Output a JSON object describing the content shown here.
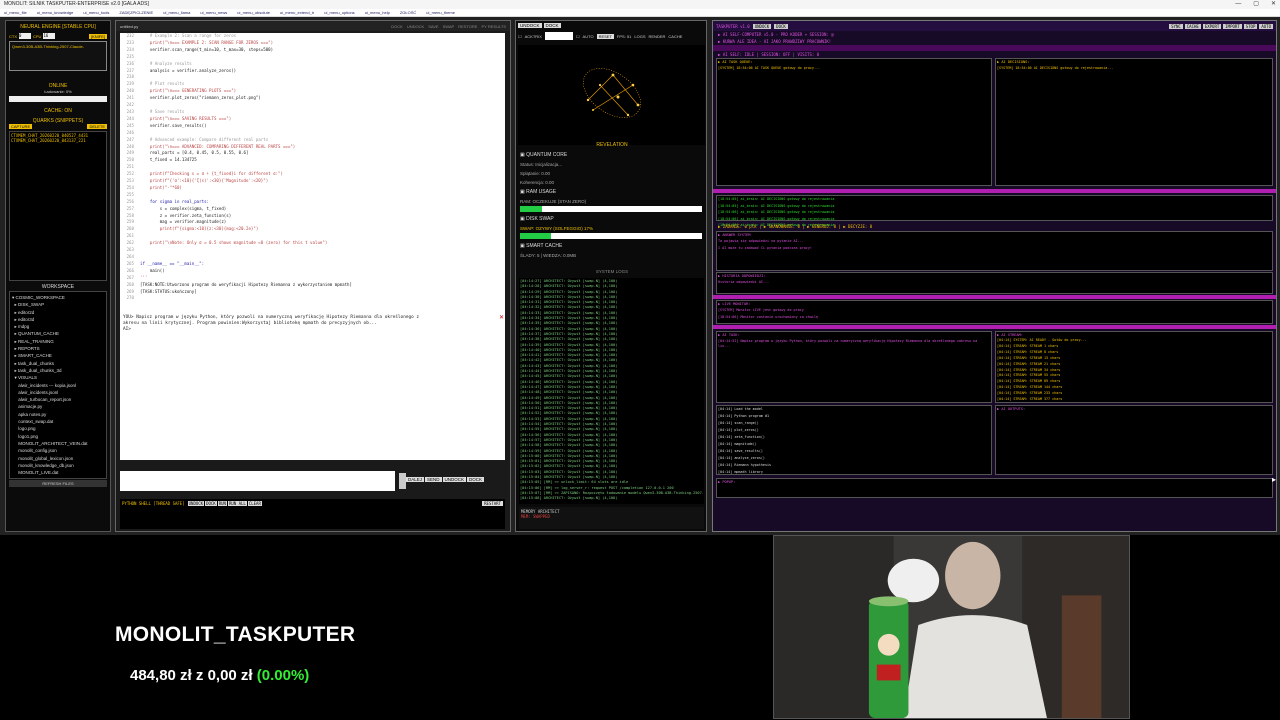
{
  "window": {
    "title": "MONOLIT: SILNIK TASKPUTER-ENTERPRISE v2.0 [GALA ADS]",
    "controls": [
      "—",
      "▢",
      "✕"
    ]
  },
  "menu": [
    "ui_menu_file",
    "ui_menu_knowledge",
    "ui_menu_tools",
    "ZADĘZPICLZENIE",
    "ui_menu_llama",
    "ui_menu_news",
    "ui_menu_obsolute",
    "ui_menu_extend_tr",
    "ui_menu_options",
    "ui_menu_help",
    "ZGŁOŚĆ",
    "ui_menu_theme"
  ],
  "left": {
    "engine_title": "NEURAL ENGINE [STABLE CPU]",
    "ctx_label": "CTX",
    "ctx_value": "0",
    "cpu_label": "CPU",
    "cpu_value": "16",
    "knife_label": "[KNIFE]",
    "model": "Qwen3-30B-A3B-Thinking-2507-Claude-",
    "online": "ONLINE",
    "loading": "Ładowanie: 0%",
    "cache": "CACHE: ON",
    "quarks_title": "QUARKS (SNIPPETS)",
    "capture": "CAPTURE",
    "delete": "DELETE",
    "quarks": [
      "CTXMEM_CHAT_20260220_040527_4431",
      "CTXMEM_CHAT_20260220_043137_221"
    ],
    "workspace_title": "WORKSPACE",
    "workspace": [
      "▾ COSMIC_WORKSPACE",
      "  ▸ DISK_SWAP",
      "  ▸ editor2d",
      "  ▸ editor3d",
      "  ▸ mdpg",
      "  ▸ QUANTUM_CACHE",
      "  ▸ REAL_TRAINING",
      "  ▸ REPORTS",
      "  ▸ SMART_CACHE",
      "  ▸ task_dual_chunks",
      "  ▸ task_dual_chunks_3d",
      "  ▾ VISUALS",
      "     alwir_incidents --- kopia.jsonl",
      "     alwir_incidents.jsonl",
      "     alwir_turbocan_report.json",
      "     animacje.py",
      "     apka notes.py",
      "     context_swap.dat",
      "     logo.png",
      "     logo1.png",
      "     MONOLIT_ARCHITECT_VEIN.dat",
      "     monolit_config.json",
      "     monolit_global_lexicon.json",
      "     monolit_knowledge_db.json",
      "     MONOLIT_LIVE.dat"
    ],
    "refresh": "REFRESH FILES"
  },
  "editor": {
    "tab": "untitled.py",
    "tab_actions": [
      "DOCK",
      "UNDOCK",
      "SAVE",
      "SWAP",
      "RESTORE",
      "PY RESULTS"
    ],
    "code": [
      {
        "n": "232",
        "t": "    # Example 2: Scan a range for zeros",
        "c": "cm"
      },
      {
        "n": "233",
        "t": "    print(\"\\n=== EXAMPLE 2: SCAN RANGE FOR ZEROS ===\")",
        "c": "st"
      },
      {
        "n": "234",
        "t": "    verifier.scan_range(t_min=10, t_max=30, steps=500)",
        "c": ""
      },
      {
        "n": "235",
        "t": "",
        "c": ""
      },
      {
        "n": "236",
        "t": "    # Analyze results",
        "c": "cm"
      },
      {
        "n": "237",
        "t": "    analysis = verifier.analyze_zeros()",
        "c": ""
      },
      {
        "n": "238",
        "t": "",
        "c": ""
      },
      {
        "n": "239",
        "t": "    # Plot results",
        "c": "cm"
      },
      {
        "n": "240",
        "t": "    print(\"\\n=== GENERATING PLOTS ===\")",
        "c": "st"
      },
      {
        "n": "241",
        "t": "    verifier.plot_zeros(\"riemann_zeros_plot.png\")",
        "c": ""
      },
      {
        "n": "242",
        "t": "",
        "c": ""
      },
      {
        "n": "243",
        "t": "    # Save results",
        "c": "cm"
      },
      {
        "n": "244",
        "t": "    print(\"\\n=== SAVING RESULTS ===\")",
        "c": "st"
      },
      {
        "n": "245",
        "t": "    verifier.save_results()",
        "c": ""
      },
      {
        "n": "246",
        "t": "",
        "c": ""
      },
      {
        "n": "247",
        "t": "    # Advanced example: Compare different real parts",
        "c": "cm"
      },
      {
        "n": "248",
        "t": "    print(\"\\n=== ADVANCED: COMPARING DIFFERENT REAL PARTS ===\")",
        "c": "st"
      },
      {
        "n": "249",
        "t": "    real_parts = [0.4, 0.45, 0.5, 0.55, 0.6]",
        "c": ""
      },
      {
        "n": "250",
        "t": "    t_fixed = 14.134725",
        "c": ""
      },
      {
        "n": "251",
        "t": "",
        "c": ""
      },
      {
        "n": "252",
        "t": "    print(f\"Checking s = σ + {t_fixed}i for different σ:\")",
        "c": "st"
      },
      {
        "n": "253",
        "t": "    print(f\"{'σ':<10}{'ζ(s)':<30}{'Magnitude':<20}\")",
        "c": "st"
      },
      {
        "n": "254",
        "t": "    print(\"-\"*60)",
        "c": "st"
      },
      {
        "n": "255",
        "t": "",
        "c": ""
      },
      {
        "n": "256",
        "t": "    for sigma in real_parts:",
        "c": "kw"
      },
      {
        "n": "257",
        "t": "        s = complex(sigma, t_fixed)",
        "c": ""
      },
      {
        "n": "258",
        "t": "        z = verifier.zeta_function(s)",
        "c": ""
      },
      {
        "n": "259",
        "t": "        mag = verifier.magnitude(z)",
        "c": ""
      },
      {
        "n": "260",
        "t": "        print(f\"{sigma:<10}{z:<30}{mag:<20.2e}\")",
        "c": "st"
      },
      {
        "n": "261",
        "t": "",
        "c": ""
      },
      {
        "n": "262",
        "t": "    print(\"\\nNote: Only σ = 0.5 shows magnitude ≈0 (zero) for this t value\")",
        "c": "st"
      },
      {
        "n": "263",
        "t": "",
        "c": ""
      },
      {
        "n": "264",
        "t": "",
        "c": ""
      },
      {
        "n": "265",
        "t": "if __name__ == \"__main__\":",
        "c": "kw"
      },
      {
        "n": "266",
        "t": "    main()",
        "c": ""
      },
      {
        "n": "267",
        "t": "'''",
        "c": "st"
      },
      {
        "n": "268",
        "t": "[TASK:NOTE:Utworzono program do weryfikacji Hipotezy Riemanna z wykorzystaniem mpmath]",
        "c": ""
      },
      {
        "n": "269",
        "t": "[TASK:STATUS:ukończony]",
        "c": ""
      },
      {
        "n": "270",
        "t": "",
        "c": ""
      }
    ],
    "terminal": [
      "YOU> Napisz program w języku Python, który pozwoli na numeryczną weryfikację Hipotezy Riemanna dla określonego z",
      "akresu na linii krytycznej. Program powinien:Wykorzystaj bibliotekę mpmath do precyzyjnych ob...",
      "AI>"
    ],
    "actions": [
      "DALEJ",
      "SEND",
      "UNDOCK",
      "DOCK"
    ],
    "shell_label": "PYTHON SHELL [THREAD SAFE]",
    "shell_buttons": [
      "UNDOCK",
      "DOCK",
      "RUN",
      "RUN ALL",
      "CLEAR"
    ],
    "shell_right": "RESTART"
  },
  "middle": {
    "top_buttons": [
      "UNDOCK",
      "DOCK"
    ],
    "row2": {
      "label": "ACKTRIX",
      "auto": "AUTO",
      "reset": "RESET",
      "fps": "FPS: 51",
      "extras": [
        "LOGS",
        "RENDER",
        "CACHE"
      ]
    },
    "viz_caption": "REVELATION",
    "quantum_title": "QUANTUM CORE",
    "quantum_status": "Status: Inicjalizacja...",
    "quantum_split": "Splątanie: 0.00",
    "quantum_coh": "Koherencja: 0.00",
    "ram_title": "RAM USAGE",
    "ram_status": "RAM: OCZEKUJE (STAN ZERO)",
    "ram_fill": 0.12,
    "disk_title": "DISK SWAP",
    "disk_status": "SWAP: OZYWY (SOLFEGGIO) 17%",
    "disk_fill": 0.17,
    "smart_title": "SMART CACHE",
    "smart_status": "ŚLADY: 5 | WIEDZA: 0.0MB",
    "syslogs_title": "SYSTEM LOGS",
    "logs": [
      "[04:14:27] ARCHITECT: Ożywił [swap-N] (4,100)",
      "[04:14:28] ARCHITECT: Ożywił [swap-N] (4,100)",
      "[04:14:29] ARCHITECT: Ożywił [swap-N] (4,100)",
      "[04:14:30] ARCHITECT: Ożywił [swap-N] (4,100)",
      "[04:14:31] ARCHITECT: Ożywił [swap-N] (4,100)",
      "[04:14:32] ARCHITECT: Ożywił [swap-N] (4,100)",
      "[04:14:33] ARCHITECT: Ożywił [swap-N] (4,100)",
      "[04:14:34] ARCHITECT: Ożywił [swap-N] (4,100)",
      "[04:14:35] ARCHITECT: Ożywił [swap-N] (4,100)",
      "[04:14:36] ARCHITECT: Ożywił [swap-N] (4,100)",
      "[04:14:37] ARCHITECT: Ożywił [swap-N] (4,100)",
      "[04:14:38] ARCHITECT: Ożywił [swap-N] (4,100)",
      "[04:14:39] ARCHITECT: Ożywił [swap-N] (4,100)",
      "[04:14:40] ARCHITECT: Ożywił [swap-N] (4,100)",
      "[04:14:41] ARCHITECT: Ożywił [swap-N] (4,100)",
      "[04:14:42] ARCHITECT: Ożywił [swap-N] (4,100)",
      "[04:14:43] ARCHITECT: Ożywił [swap-N] (4,100)",
      "[04:14:44] ARCHITECT: Ożywił [swap-N] (4,100)",
      "[04:14:45] ARCHITECT: Ożywił [swap-N] (4,100)",
      "[04:14:46] ARCHITECT: Ożywił [swap-N] (4,100)",
      "[04:14:47] ARCHITECT: Ożywił [swap-N] (4,100)",
      "[04:14:48] ARCHITECT: Ożywił [swap-N] (4,100)",
      "[04:14:49] ARCHITECT: Ożywił [swap-N] (4,100)",
      "[04:14:50] ARCHITECT: Ożywił [swap-N] (4,100)",
      "[04:14:51] ARCHITECT: Ożywił [swap-N] (4,100)",
      "[04:14:52] ARCHITECT: Ożywił [swap-N] (4,100)",
      "[04:14:53] ARCHITECT: Ożywił [swap-N] (4,100)",
      "[04:14:54] ARCHITECT: Ożywił [swap-N] (4,100)",
      "[04:14:55] ARCHITECT: Ożywił [swap-N] (4,100)",
      "[04:14:56] ARCHITECT: Ożywił [swap-N] (4,100)",
      "[04:14:57] ARCHITECT: Ożywił [swap-N] (4,100)",
      "[04:14:58] ARCHITECT: Ożywił [swap-N] (4,100)",
      "[04:14:59] ARCHITECT: Ożywił [swap-N] (4,100)",
      "[04:15:00] ARCHITECT: Ożywił [swap-N] (4,100)",
      "[04:15:01] ARCHITECT: Ożywił [swap-N] (4,100)",
      "[04:15:02] ARCHITECT: Ożywił [swap-N] (4,100)",
      "[04:15:03] ARCHITECT: Ożywił [swap-N] (4,100)",
      "[04:15:04] ARCHITECT: Ożywił [swap-N] (4,100)",
      "[04:15:05] [RM] >> unlock_limit: 64 slots are idle",
      "[04:15:06] [RM] >> log_server_r: request POST /completion 127.0.0.1 200",
      "[04:15:07] [RM] >> ZAPISANO: Rozpoczęto ładowanie modelu Qwen3-30B-A3B-Thinking-2507-Claude-4.5-Sonnet-High-Reasoning-Distill-q8_0.gguf",
      "[04:15:08] ARCHITECT: Ożywił [swap-N] (4,100)"
    ],
    "mem_title": "MEMORY ARCHITECT",
    "mem_status": "MEM: SWAPPED"
  },
  "right": {
    "title": "TASKPUTER v1.0",
    "head_buttons": [
      "UNDOCK",
      "DOCK"
    ],
    "head_right": [
      "SYNC",
      "CACHE",
      "EXPORT",
      "IMPORT",
      "STOP",
      "AUTO"
    ],
    "lines": [
      "▶ AI SELF-COMPUTER v5.0 - PRO KODER + SESSION: @",
      "▶ KURWA ALE IDEA - AI JAKO PRAWDZIWY PRACOWNIK!",
      "▶ AI SELF: IDLE | SESSION: OFF | VISITS: 0"
    ],
    "task_cap": "▶ AI TASK QUEUE:",
    "decision_cap": "▶ AI DECISIONS:",
    "task_log": "[SYSTEM] 18:54:06 AI TASK QUEUE gotowy do pracy...",
    "decision_log": "[SYSTEM] 18:54:06 AI DECISIONS gotowy do rejestrowania...",
    "midlog": [
      "[18:54:05] ai_brain: AI DECISIONS gotowy do rejestrowania",
      "[18:54:05] ai_brain: AI DECISIONS gotowy do rejestrowania",
      "[18:54:06] ai_brain: AI DECISIONS gotowy do rejestrowania",
      "[18:54:06] ai_brain: AI DECISIONS gotowy do rejestrowania",
      "[18:54:06] ai_brain: AI DECISIONS gotowy do rejestrowania"
    ],
    "stats": "▶ ZADANIE: 0 plk | ▶ SKANOWANIE: 0 | ▶ GENERUJ: 0 | ▶ DECYZJE: 0",
    "answer_cap": "▶ ANSWER SYSTEM",
    "answer_lines": [
      "Ta pojawią się odpowiedzi na pytanie AI...",
      "I AI może tu zadawać Ci pytania podczas pracy!"
    ],
    "history_cap": "▶ HISTORIA ODPOWIEDZI:",
    "history_line": "Historia odpowiedzi AI...",
    "live_cap": "▶ LIVE MONITOR:",
    "live_lines": [
      "[SYSTEM] Monitor LIVE jest gotowy do pracy",
      "[18:54:06] Monitor zostanie uruchomiony za chwilę",
      "[18:54:07] Rozpoczynam monitorowanie"
    ],
    "bottom_left_cap": "▶ AI TASK:",
    "bottom_left": "[04:14:52] Napisz program w języku Python, który pozwoli na numeryczną weryfikację Hipotezy Riemanna dla określonego zakresu na lin...",
    "bottom_right_cap": "▶ AI STREAM:",
    "bottom_right": [
      "[04:14] SYSTEM: AI READY - Gotów do pracy...",
      "[04:14] STREAM: STREAM 1 chars",
      "[04:14] STREAM: STREAM 8 chars",
      "[04:14] STREAM: STREAM 13 chars",
      "[04:14] STREAM: STREAM 21 chars",
      "[04:14] STREAM: STREAM 34 chars",
      "[04:14] STREAM: STREAM 55 chars",
      "[04:14] STREAM: STREAM 89 chars",
      "[04:14] STREAM: STREAM 144 chars",
      "[04:14] STREAM: STREAM 233 chars",
      "[04:14] STREAM: STREAM 377 chars",
      "[04:14] STREAM: STREAM 610 chars",
      "[04:14] STREAM: STREAM 987 chars",
      "[04:14] STREAM: STREAM 1597 chars",
      "[04:14] STREAM: STREAM 2584 chars",
      "[04:14] STREAM: STREAM 4181 chars"
    ],
    "bottom2_left": [
      "[04:14] Load the model",
      "[04:14] Python program #1",
      "[04:14] scan_range()",
      "[04:14] plot_zeros()",
      "[04:14] zeta_function()",
      "[04:14] magnitude()",
      "[04:14] save_results()",
      "[04:14] analyze_zeros()",
      "[04:14] Riemann hypothesis",
      "[04:14] mpmath library",
      "[04:14] critical line",
      "[04:14] Real parts compare",
      "[04:14] DONE"
    ],
    "bottom2_right_cap": "▶ AI OUTPUTS:",
    "footer_cap": "▶ POPUP:"
  },
  "overlay": {
    "brand": "MONOLIT_TASKPUTER",
    "price_main": "484,80 zł",
    "price_z": "z",
    "price_change": "0,00 zł",
    "price_pct": "(0.00%)"
  }
}
